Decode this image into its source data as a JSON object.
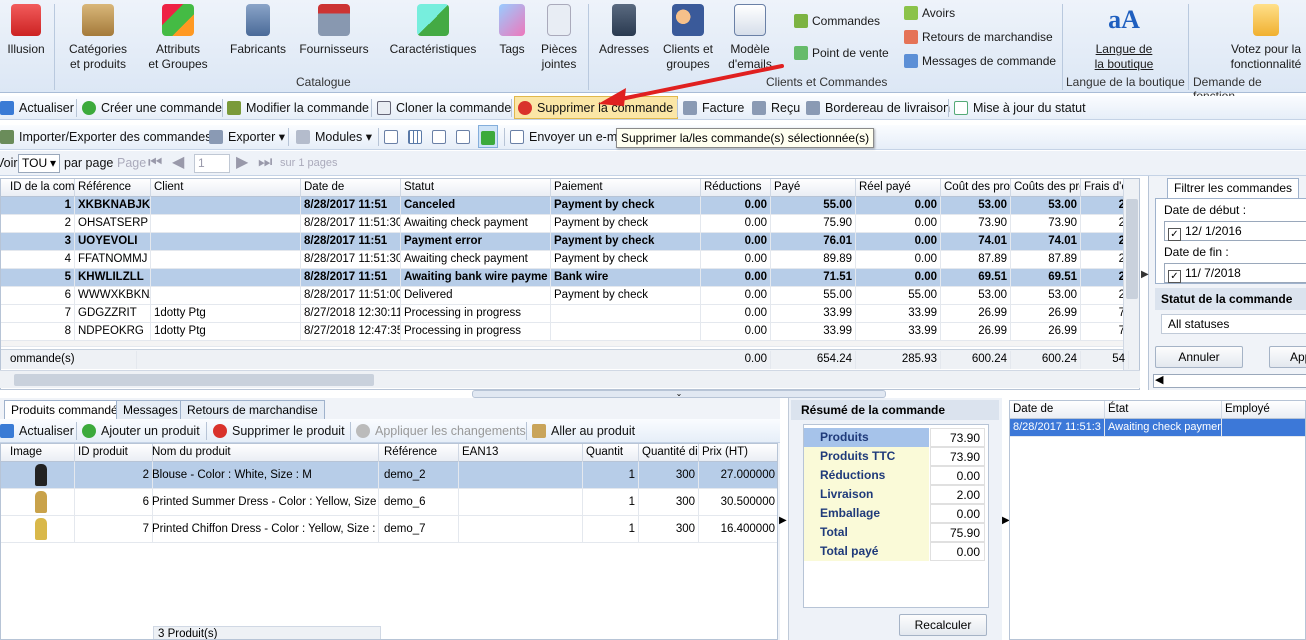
{
  "ribbon": {
    "illusion": "Illusion",
    "categories": "Catégories\net produits",
    "attributes": "Attributs\net Groupes",
    "manufacturers": "Fabricants",
    "suppliers": "Fournisseurs",
    "features": "Caractéristiques",
    "tags": "Tags",
    "attachments": "Pièces\njointes",
    "catalogue_group": "Catalogue",
    "addresses": "Adresses",
    "clients": "Clients et\ngroupes",
    "email_model": "Modèle\nd'emails",
    "orders": "Commandes",
    "pos": "Point de vente",
    "credits": "Avoirs",
    "returns": "Retours de marchandise",
    "order_messages": "Messages de commande",
    "clients_group": "Clients et Commandes",
    "shop_language": "Langue de\nla boutique",
    "shop_language_group": "Langue de la boutique",
    "vote": "Votez pour la\nfonctionnalité",
    "vote_group": "Demande de fonction"
  },
  "toolbar1": {
    "refresh": "Actualiser",
    "create": "Créer une commande",
    "modify": "Modifier la commande",
    "clone": "Cloner la commande",
    "delete": "Supprimer la commande",
    "invoice": "Facture",
    "receipt": "Reçu",
    "delivery": "Bordereau de livraison",
    "status_update": "Mise à jour du statut"
  },
  "toolbar2": {
    "import_export": "Importer/Exporter des commandes",
    "export": "Exporter",
    "modules": "Modules",
    "send_email": "Envoyer un e-ma"
  },
  "tooltip": "Supprimer la/les commande(s) sélectionnée(s)",
  "pager": {
    "voir": "Voir",
    "per_page_value": "TOU",
    "per_page_label": "par page",
    "page_label": "Page",
    "page_value": "1",
    "on_pages": "sur 1 pages"
  },
  "orders_table": {
    "headers": [
      "ID de la com",
      "Référence",
      "Client",
      "Date de",
      "Statut",
      "Paiement",
      "Réductions",
      "Payé",
      "Réel payé",
      "Coût des pro",
      "Coûts des pro",
      "Frais d'ex"
    ],
    "rows": [
      {
        "sel": true,
        "cells": [
          "1",
          "XKBKNABJK",
          "",
          "8/28/2017 11:51",
          "Canceled",
          "Payment by check",
          "0.00",
          "55.00",
          "0.00",
          "53.00",
          "53.00",
          "2"
        ]
      },
      {
        "sel": false,
        "cells": [
          "2",
          "OHSATSERP",
          "",
          "8/28/2017 11:51:30",
          "Awaiting check payment",
          "Payment by check",
          "0.00",
          "75.90",
          "0.00",
          "73.90",
          "73.90",
          "2"
        ]
      },
      {
        "sel": true,
        "cells": [
          "3",
          "UOYEVOLI",
          "",
          "8/28/2017 11:51",
          "Payment error",
          "Payment by check",
          "0.00",
          "76.01",
          "0.00",
          "74.01",
          "74.01",
          "2"
        ]
      },
      {
        "sel": false,
        "cells": [
          "4",
          "FFATNOMMJ",
          "",
          "8/28/2017 11:51:30",
          "Awaiting check payment",
          "Payment by check",
          "0.00",
          "89.89",
          "0.00",
          "87.89",
          "87.89",
          "2"
        ]
      },
      {
        "sel": true,
        "cells": [
          "5",
          "KHWLILZLL",
          "",
          "8/28/2017 11:51",
          "Awaiting bank wire payme",
          "Bank wire",
          "0.00",
          "71.51",
          "0.00",
          "69.51",
          "69.51",
          "2"
        ]
      },
      {
        "sel": false,
        "cells": [
          "6",
          "WWWXKBKNA",
          "",
          "8/28/2017 11:51:00",
          "Delivered",
          "Payment by check",
          "0.00",
          "55.00",
          "55.00",
          "53.00",
          "53.00",
          "2"
        ]
      },
      {
        "sel": false,
        "cells": [
          "7",
          "GDGZZRIT",
          "1dotty Ptg",
          "8/27/2018 12:30:11",
          "Processing in progress",
          "",
          "0.00",
          "33.99",
          "33.99",
          "26.99",
          "26.99",
          "7"
        ]
      },
      {
        "sel": false,
        "cells": [
          "8",
          "NDPEOKRG",
          "1dotty Ptg",
          "8/27/2018 12:47:35",
          "Processing in progress",
          "",
          "0.00",
          "33.99",
          "33.99",
          "26.99",
          "26.99",
          "7"
        ]
      }
    ],
    "footer": [
      "ommande(s)",
      "0.00",
      "654.24",
      "285.93",
      "600.24",
      "600.24",
      "54"
    ]
  },
  "filter": {
    "tab": "Filtrer les commandes",
    "start_label": "Date de début :",
    "start_value": "12/  1/2016",
    "end_label": "Date de fin :",
    "end_value": "11/  7/2018",
    "status_label": "Statut de la commande",
    "status_value": "All statuses",
    "cancel": "Annuler",
    "apply": "App"
  },
  "bottom_tabs": [
    "Produits commandés",
    "Messages",
    "Retours de marchandise"
  ],
  "product_toolbar": {
    "refresh": "Actualiser",
    "add": "Ajouter un produit",
    "delete": "Supprimer le produit",
    "apply": "Appliquer les changements",
    "goto": "Aller au produit"
  },
  "products_table": {
    "headers": [
      "Image",
      "ID produit",
      "Nom du produit",
      "Référence",
      "EAN13",
      "Quantit",
      "Quantité di",
      "Prix (HT)"
    ],
    "rows": [
      {
        "sel": true,
        "cells": [
          "",
          "2",
          "Blouse - Color : White, Size : M",
          "demo_2",
          "",
          "1",
          "300",
          "27.000000"
        ]
      },
      {
        "sel": false,
        "cells": [
          "",
          "6",
          "Printed Summer Dress - Color : Yellow, Size : M",
          "demo_6",
          "",
          "1",
          "300",
          "30.500000"
        ]
      },
      {
        "sel": false,
        "cells": [
          "",
          "7",
          "Printed Chiffon Dress - Color : Yellow, Size : S",
          "demo_7",
          "",
          "1",
          "300",
          "16.400000"
        ]
      }
    ],
    "footer": "3 Produit(s)"
  },
  "summary": {
    "title": "Résumé de la commande",
    "rows": [
      {
        "label": "Produits",
        "value": "73.90"
      },
      {
        "label": "Produits TTC",
        "value": "73.90"
      },
      {
        "label": "Réductions",
        "value": "0.00"
      },
      {
        "label": "Livraison",
        "value": "2.00"
      },
      {
        "label": "Emballage",
        "value": "0.00"
      },
      {
        "label": "Total",
        "value": "75.90"
      },
      {
        "label": "Total payé",
        "value": "0.00"
      }
    ],
    "recalc": "Recalculer"
  },
  "history": {
    "headers": [
      "Date de",
      "État",
      "Employé"
    ],
    "row": [
      "8/28/2017 11:51:3",
      "Awaiting check paymen",
      ""
    ]
  },
  "colors": {
    "accent": "#3c78d8",
    "selected_row": "#b7cde8",
    "arrow": "#e02020"
  }
}
